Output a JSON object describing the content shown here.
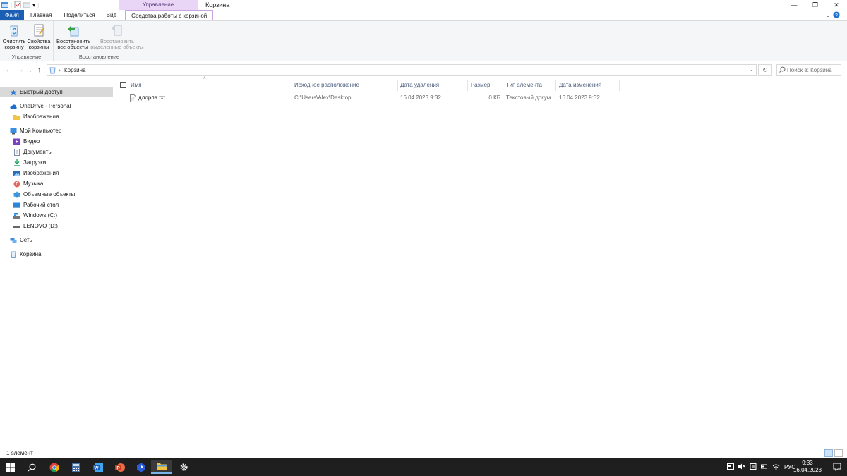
{
  "window": {
    "title": "Корзина",
    "context_group": "Управление",
    "controls": [
      "—",
      "❐",
      "✕"
    ]
  },
  "ribbon": {
    "tabs": [
      "Файл",
      "Главная",
      "Поделиться",
      "Вид",
      "Средства работы с корзиной"
    ],
    "groups": {
      "manage": {
        "name": "Управление",
        "empty_label": "Очистить корзину",
        "props_label": "Свойства корзины"
      },
      "restore": {
        "name": "Восстановление",
        "restore_all_label": "Восстановить все объекты",
        "restore_sel_label": "Восстановить выделенные объекты"
      }
    }
  },
  "address": {
    "path": "Корзина",
    "search_placeholder": "Поиск в: Корзина"
  },
  "navpane": {
    "quick_access": "Быстрый доступ",
    "onedrive": "OneDrive - Personal",
    "onedrive_images": "Изображения",
    "my_computer": "Мой Компьютер",
    "video": "Видео",
    "documents": "Документы",
    "downloads": "Загрузки",
    "images": "Изображения",
    "music": "Музыка",
    "objects3d": "Объемные объекты",
    "desktop": "Рабочий стол",
    "drive_c": "Windows (C:)",
    "drive_d": "LENOVO (D:)",
    "network": "Сеть",
    "recycle": "Корзина"
  },
  "columns": {
    "name": "Имя",
    "origin": "Исходное расположение",
    "deleted": "Дата удаления",
    "size": "Размер",
    "type": "Тип элемента",
    "modified": "Дата изменения"
  },
  "files": [
    {
      "name": "длорпа.txt",
      "origin": "C:\\Users\\Alex\\Desktop",
      "deleted": "16.04.2023 9:32",
      "size": "0 КБ",
      "type": "Текстовый докум...",
      "modified": "16.04.2023 9:32"
    }
  ],
  "status": {
    "count": "1 элемент"
  },
  "taskbar": {
    "lang": "РУС",
    "time": "9:33",
    "date": "16.04.2023"
  },
  "colors": {
    "file_tab": "#1a5fb4",
    "context_tab": "#e9d5f5",
    "taskbar": "#1f1f1f",
    "selection": "#d9d9d9"
  }
}
